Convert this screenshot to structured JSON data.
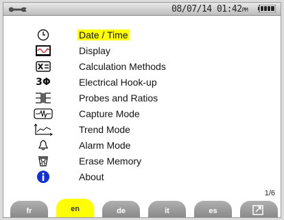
{
  "status": {
    "date": "08/07/14",
    "time": "01:42",
    "ampm": "PM"
  },
  "menu": {
    "items": [
      {
        "label": "Date / Time",
        "icon": "clock-icon",
        "selected": true
      },
      {
        "label": "Display",
        "icon": "display-icon",
        "selected": false
      },
      {
        "label": "Calculation Methods",
        "icon": "calculation-icon",
        "selected": false
      },
      {
        "label": "Electrical Hook-up",
        "icon": "three-phase-icon",
        "selected": false
      },
      {
        "label": "Probes and Ratios",
        "icon": "probe-icon",
        "selected": false
      },
      {
        "label": "Capture Mode",
        "icon": "capture-icon",
        "selected": false
      },
      {
        "label": "Trend Mode",
        "icon": "trend-icon",
        "selected": false
      },
      {
        "label": "Alarm Mode",
        "icon": "alarm-bell-icon",
        "selected": false
      },
      {
        "label": "Erase Memory",
        "icon": "erase-memory-icon",
        "selected": false
      },
      {
        "label": "About",
        "icon": "info-icon",
        "selected": false
      }
    ]
  },
  "tabs": {
    "languages": [
      "fr",
      "en",
      "de",
      "it",
      "es"
    ],
    "active": "en",
    "page": "1/6"
  },
  "colors": {
    "highlight": "#ffff00",
    "info_blue": "#1030d8",
    "tab_gray": "#9a9a9a"
  }
}
